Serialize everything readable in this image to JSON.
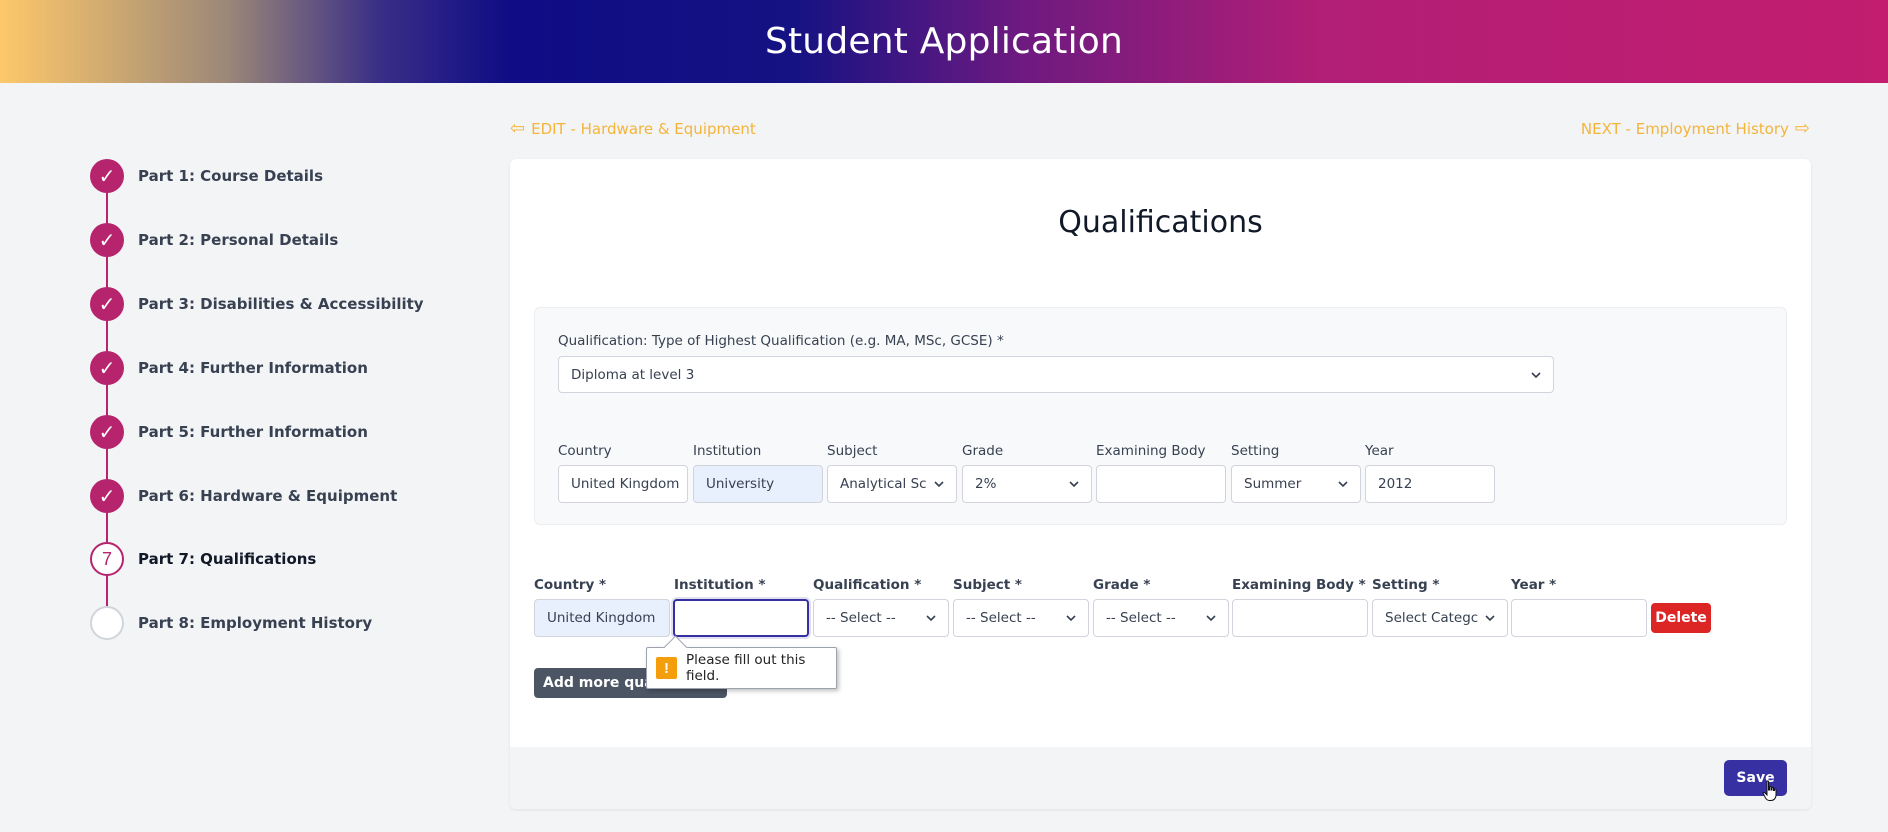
{
  "header": {
    "title": "Student Application"
  },
  "nav": {
    "prev_label": "EDIT - Hardware & Equipment",
    "next_label": "NEXT - Employment History"
  },
  "steps": [
    {
      "label": "Part 1: Course Details",
      "status": "complete"
    },
    {
      "label": "Part 2: Personal Details",
      "status": "complete"
    },
    {
      "label": "Part 3: Disabilities & Accessibility",
      "status": "complete"
    },
    {
      "label": "Part 4: Further Information",
      "status": "complete"
    },
    {
      "label": "Part 5: Further Information",
      "status": "complete"
    },
    {
      "label": "Part 6: Hardware & Equipment",
      "status": "complete"
    },
    {
      "label": "Part 7: Qualifications",
      "status": "current",
      "number": "7"
    },
    {
      "label": "Part 8: Employment History",
      "status": "todo"
    }
  ],
  "page": {
    "title": "Qualifications",
    "highest": {
      "label": "Qualification: Type of Highest Qualification (e.g. MA, MSc, GCSE) *",
      "value": "Diploma at level 3"
    },
    "existing": {
      "labels": {
        "country": "Country",
        "institution": "Institution",
        "subject": "Subject",
        "grade": "Grade",
        "examining_body": "Examining Body",
        "setting": "Setting",
        "year": "Year"
      },
      "values": {
        "country": "United Kingdom",
        "institution": "University",
        "subject": "Analytical Sc",
        "grade": "2%",
        "examining_body": "",
        "setting": "Summer",
        "year": "2012"
      }
    },
    "new_row": {
      "labels": {
        "country": "Country *",
        "institution": "Institution *",
        "qualification": "Qualification *",
        "subject": "Subject *",
        "grade": "Grade *",
        "examining_body": "Examining Body *",
        "setting": "Setting *",
        "year": "Year *"
      },
      "values": {
        "country": "United Kingdom",
        "institution": "",
        "qualification": "-- Select --",
        "subject": "-- Select --",
        "grade": "-- Select --",
        "examining_body": "",
        "setting": "Select Categc",
        "year": ""
      },
      "delete_label": "Delete"
    },
    "add_more_label": "Add more qualifications",
    "validation_message": "Please fill out this field.",
    "save_label": "Save"
  },
  "colors": {
    "accent": "#b5246c",
    "primary": "#3730a3",
    "link": "#f4b43a",
    "danger": "#dc2626"
  }
}
